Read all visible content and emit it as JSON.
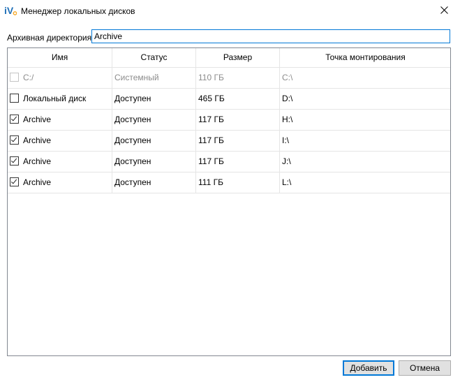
{
  "window": {
    "title": "Менеджер локальных дисков",
    "logo_text": "iV",
    "close_icon": "close-icon"
  },
  "archive_dir": {
    "label": "Архивная директория:",
    "value": "Archive"
  },
  "table": {
    "columns": [
      "Имя",
      "Статус",
      "Размер",
      "Точка монтирования"
    ],
    "rows": [
      {
        "checked": false,
        "disabled": true,
        "name": "C:/",
        "status": "Системный",
        "size": "110 ГБ",
        "mount": "C:\\"
      },
      {
        "checked": false,
        "disabled": false,
        "name": "Локальный диск",
        "status": "Доступен",
        "size": "465 ГБ",
        "mount": "D:\\"
      },
      {
        "checked": true,
        "disabled": false,
        "name": "Archive",
        "status": "Доступен",
        "size": "117 ГБ",
        "mount": "H:\\"
      },
      {
        "checked": true,
        "disabled": false,
        "name": "Archive",
        "status": "Доступен",
        "size": "117 ГБ",
        "mount": "I:\\"
      },
      {
        "checked": true,
        "disabled": false,
        "name": "Archive",
        "status": "Доступен",
        "size": "117 ГБ",
        "mount": "J:\\"
      },
      {
        "checked": true,
        "disabled": false,
        "name": "Archive",
        "status": "Доступен",
        "size": "111 ГБ",
        "mount": "L:\\"
      }
    ]
  },
  "buttons": {
    "add": "Добавить",
    "cancel": "Отмена"
  },
  "colors": {
    "accent": "#0078d7",
    "logo_blue": "#1f6fb8",
    "logo_orange": "#f5a623"
  }
}
